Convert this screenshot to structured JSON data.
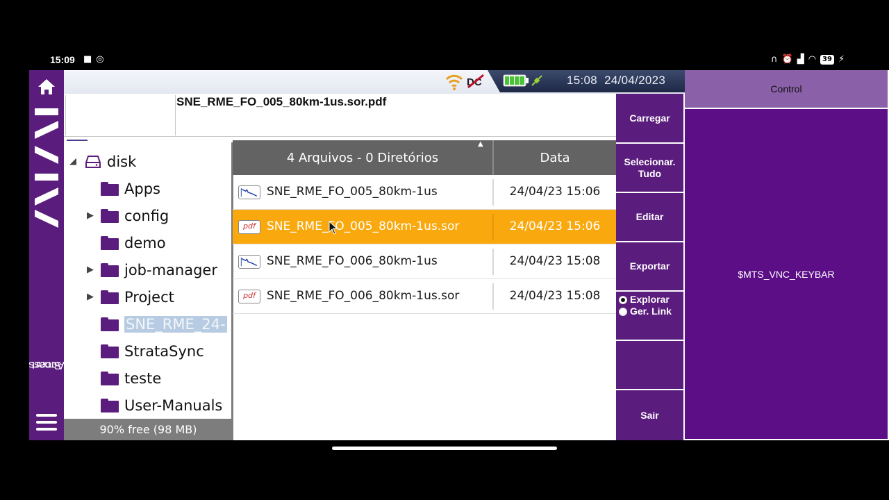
{
  "phone_status": {
    "time": "15:09",
    "left_icons": [
      "video-icon",
      "sync-icon"
    ],
    "right_icons": [
      "headset-icon",
      "alarm-icon",
      "signal-icon",
      "wifi-icon",
      "battery-icon",
      "charging-icon"
    ],
    "battery_percent": "39"
  },
  "device": {
    "clock": "15:08  24/04/2023",
    "status_icons": [
      "wifi-icon",
      "dc-power-icon",
      "battery-icon",
      "satellite-icon"
    ],
    "brand_vertical_text": [
      "Smart",
      "Access"
    ]
  },
  "header": {
    "filename": "SNE_RME_FO_005_80km-1us.sor.pdf"
  },
  "tree": {
    "root": "disk",
    "items": [
      {
        "label": "Apps",
        "expandable": false
      },
      {
        "label": "config",
        "expandable": true
      },
      {
        "label": "demo",
        "expandable": false
      },
      {
        "label": "job-manager",
        "expandable": true
      },
      {
        "label": "Project",
        "expandable": true
      },
      {
        "label": "SNE_RME_24-",
        "expandable": false,
        "selected": true
      },
      {
        "label": "StrataSync",
        "expandable": false
      },
      {
        "label": "teste",
        "expandable": false
      },
      {
        "label": "User-Manuals",
        "expandable": false
      }
    ],
    "free_space": "90% free (98 MB)"
  },
  "files": {
    "header_count": "4 Arquivos - 0 Diretórios",
    "header_date": "Data",
    "rows": [
      {
        "type": "trace",
        "name": "SNE_RME_FO_005_80km-1us",
        "date": "24/04/23 15:06",
        "selected": false
      },
      {
        "type": "pdf",
        "name": "SNE_RME_FO_005_80km-1us.sor",
        "date": "24/04/23 15:06",
        "selected": true
      },
      {
        "type": "trace",
        "name": "SNE_RME_FO_006_80km-1us",
        "date": "24/04/23 15:08",
        "selected": false
      },
      {
        "type": "pdf",
        "name": "SNE_RME_FO_006_80km-1us.sor",
        "date": "24/04/23 15:08",
        "selected": false
      }
    ],
    "pdf_icon_text": "pdf"
  },
  "actions": {
    "load": "Carregar",
    "select_all": "Selecionar. Tudo",
    "edit": "Editar",
    "export": "Exportar",
    "mode_explore": "Explorar",
    "mode_link": "Ger. Link",
    "exit": "Sair"
  },
  "control": {
    "title": "Control",
    "body": "$MTS_VNC_KEYBAR"
  },
  "colors": {
    "brand_purple": "#5b1d7d",
    "selection_orange": "#f9a90d",
    "control_header": "#8a61a8"
  }
}
